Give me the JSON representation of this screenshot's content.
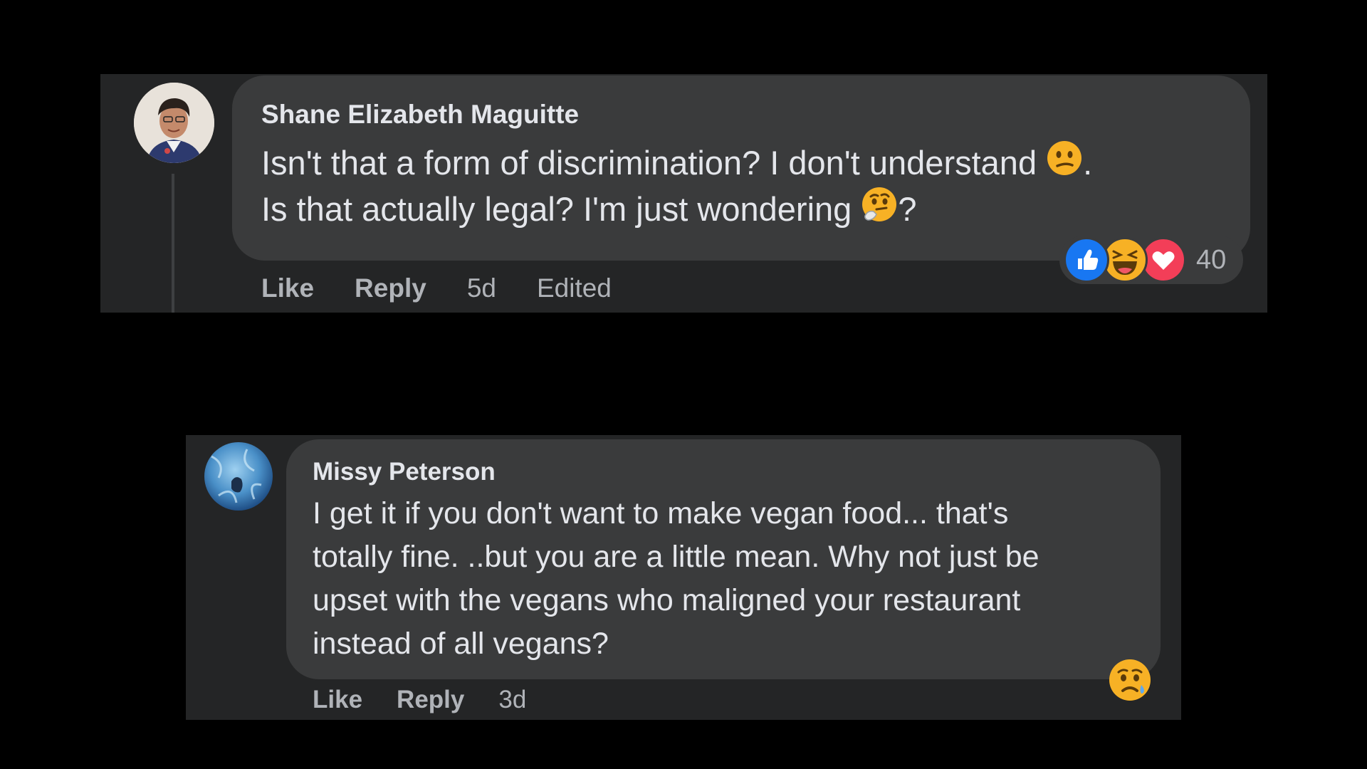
{
  "comments": [
    {
      "author": "Shane Elizabeth Maguitte",
      "text_line1": "Isn't that a form of discrimination? I don't understand",
      "text_line1_end": ".",
      "text_line2": "Is that actually legal? I'm just wondering",
      "text_line2_end": "?",
      "inline_emojis": [
        "confused-face",
        "thinking-face"
      ],
      "actions": {
        "like": "Like",
        "reply": "Reply",
        "time": "5d",
        "edited": "Edited"
      },
      "reactions": {
        "icons": [
          "like",
          "haha",
          "love"
        ],
        "count": "40"
      }
    },
    {
      "author": "Missy Peterson",
      "text_lines": [
        "I get it if you don't want to make vegan food... that's",
        "totally fine. ..but you are a little mean. Why not just be",
        "upset with the vegans who maligned your restaurant",
        "instead of all vegans?"
      ],
      "actions": {
        "like": "Like",
        "reply": "Reply",
        "time": "3d"
      },
      "reactions": {
        "icons": [
          "sad"
        ]
      }
    }
  ],
  "colors": {
    "background": "#000000",
    "panel": "#242526",
    "bubble": "#3a3b3c",
    "primary_text": "#e4e6eb",
    "secondary_text": "#b0b3b8",
    "like_blue": "#1877f2",
    "love_red": "#f33e58",
    "emoji_yellow": "#f7b125"
  }
}
